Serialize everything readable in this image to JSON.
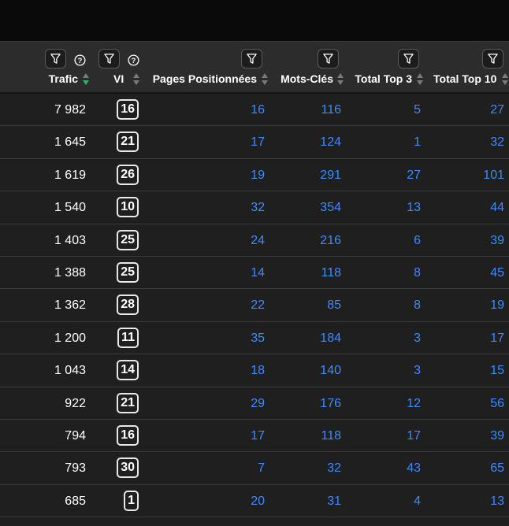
{
  "columns": {
    "trafic": "Trafic",
    "vi": "VI",
    "pages": "Pages Positionnées",
    "mots": "Mots-Clés",
    "top3": "Total Top 3",
    "top10": "Total Top 10"
  },
  "colors": {
    "link": "#3d8bff",
    "sort_active": "#2db55d",
    "background": "#1f1f1f",
    "header": "#2c2c2c"
  },
  "rows": [
    {
      "trafic": "7 982",
      "vi": "16",
      "pages": "16",
      "mots": "116",
      "top3": "5",
      "top10": "27"
    },
    {
      "trafic": "1 645",
      "vi": "21",
      "pages": "17",
      "mots": "124",
      "top3": "1",
      "top10": "32"
    },
    {
      "trafic": "1 619",
      "vi": "26",
      "pages": "19",
      "mots": "291",
      "top3": "27",
      "top10": "101"
    },
    {
      "trafic": "1 540",
      "vi": "10",
      "pages": "32",
      "mots": "354",
      "top3": "13",
      "top10": "44"
    },
    {
      "trafic": "1 403",
      "vi": "25",
      "pages": "24",
      "mots": "216",
      "top3": "6",
      "top10": "39"
    },
    {
      "trafic": "1 388",
      "vi": "25",
      "pages": "14",
      "mots": "118",
      "top3": "8",
      "top10": "45"
    },
    {
      "trafic": "1 362",
      "vi": "28",
      "pages": "22",
      "mots": "85",
      "top3": "8",
      "top10": "19"
    },
    {
      "trafic": "1 200",
      "vi": "11",
      "pages": "35",
      "mots": "184",
      "top3": "3",
      "top10": "17"
    },
    {
      "trafic": "1 043",
      "vi": "14",
      "pages": "18",
      "mots": "140",
      "top3": "3",
      "top10": "15"
    },
    {
      "trafic": "922",
      "vi": "21",
      "pages": "29",
      "mots": "176",
      "top3": "12",
      "top10": "56"
    },
    {
      "trafic": "794",
      "vi": "16",
      "pages": "17",
      "mots": "118",
      "top3": "17",
      "top10": "39"
    },
    {
      "trafic": "793",
      "vi": "30",
      "pages": "7",
      "mots": "32",
      "top3": "43",
      "top10": "65"
    },
    {
      "trafic": "685",
      "vi": "1",
      "pages": "20",
      "mots": "31",
      "top3": "4",
      "top10": "13"
    }
  ]
}
